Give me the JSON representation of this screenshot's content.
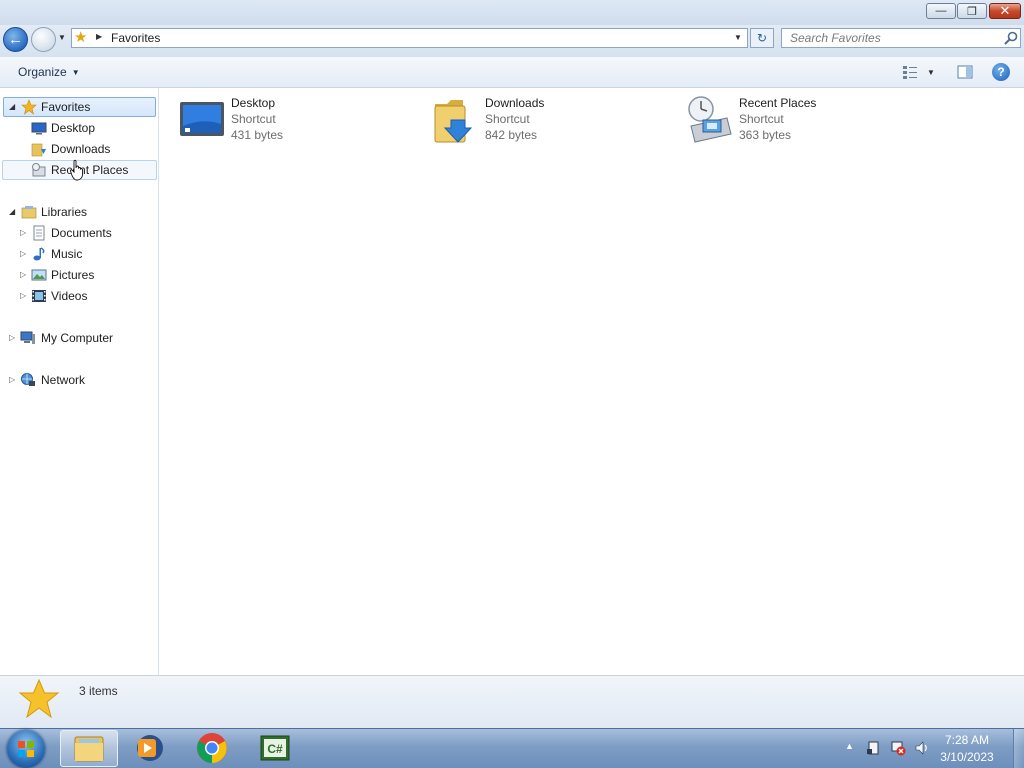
{
  "window": {
    "minimize_glyph": "—",
    "maximize_glyph": "❐",
    "close_glyph": "✕"
  },
  "navigation": {
    "back_glyph": "←",
    "forward_glyph": "→",
    "address_path": "Favorites",
    "refresh_glyph": "↻",
    "search_placeholder": "Search Favorites"
  },
  "toolbar": {
    "organize_label": "Organize",
    "help_glyph": "?"
  },
  "sidebar": {
    "favorites": {
      "label": "Favorites",
      "items": [
        {
          "label": "Desktop",
          "icon": "desktop-icon"
        },
        {
          "label": "Downloads",
          "icon": "downloads-folder-icon"
        },
        {
          "label": "Recent Places",
          "icon": "recent-places-icon"
        }
      ]
    },
    "libraries": {
      "label": "Libraries",
      "items": [
        {
          "label": "Documents",
          "icon": "documents-icon"
        },
        {
          "label": "Music",
          "icon": "music-icon"
        },
        {
          "label": "Pictures",
          "icon": "pictures-icon"
        },
        {
          "label": "Videos",
          "icon": "videos-icon"
        }
      ]
    },
    "computer": {
      "label": "My Computer",
      "icon": "computer-icon"
    },
    "network": {
      "label": "Network",
      "icon": "network-icon"
    }
  },
  "files": [
    {
      "name": "Desktop",
      "type": "Shortcut",
      "size": "431 bytes",
      "icon": "desktop-shortcut-icon"
    },
    {
      "name": "Downloads",
      "type": "Shortcut",
      "size": "842 bytes",
      "icon": "downloads-shortcut-icon"
    },
    {
      "name": "Recent Places",
      "type": "Shortcut",
      "size": "363 bytes",
      "icon": "recent-places-shortcut-icon"
    }
  ],
  "details": {
    "item_count": "3 items"
  },
  "taskbar": {
    "apps": [
      "windows-explorer",
      "media-player",
      "google-chrome",
      "csharp-ide"
    ],
    "clock_time": "7:28 AM",
    "clock_date": "3/10/2023",
    "tray_up_glyph": "▲"
  },
  "colors": {
    "accent": "#2b6cc4",
    "selection": "#d3e6fa",
    "taskbar": "#7e9dc4"
  }
}
